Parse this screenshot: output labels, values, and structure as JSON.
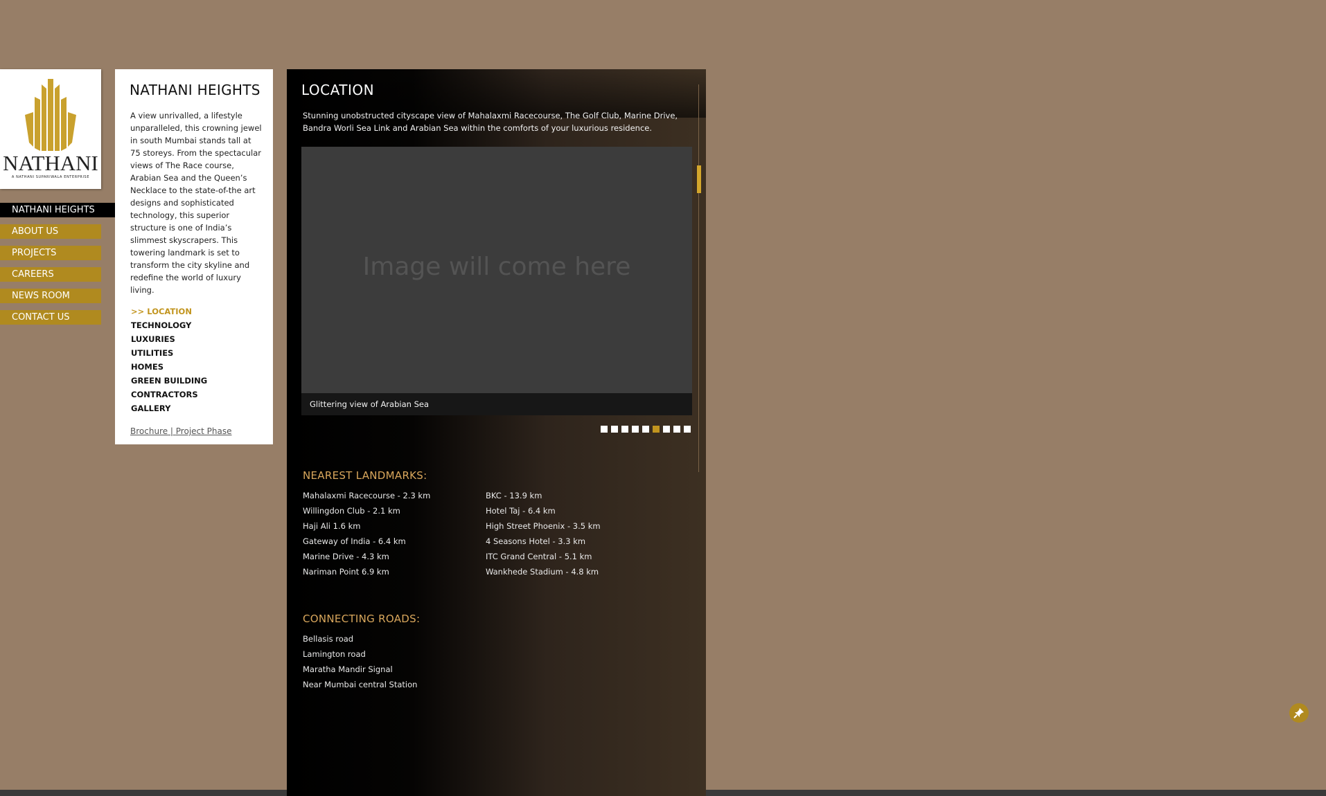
{
  "colors": {
    "background": "#977e67",
    "accent_gold": "#b08a1f",
    "active_gold": "#c2951f",
    "heading_tan": "#d9a75c",
    "panel_white": "#ffffff",
    "panel_dark": "#000000"
  },
  "logo": {
    "wordmark": "NATHANI",
    "tagline": "A NATHANI SUPARIWALA ENTERPRISE",
    "icon": "nathani-crown-logo"
  },
  "nav": {
    "active": "NATHANI HEIGHTS",
    "items": [
      {
        "label": "ABOUT US"
      },
      {
        "label": "PROJECTS"
      },
      {
        "label": "CAREERS"
      },
      {
        "label": "NEWS ROOM"
      },
      {
        "label": "CONTACT US"
      }
    ]
  },
  "info": {
    "title": "NATHANI HEIGHTS",
    "description": "A view unrivalled, a lifestyle unparalleled, this crowning jewel in south Mumbai stands tall at 75 storeys. From the spectacular views of The Race course, Arabian Sea and the Queen’s Necklace to the state-of-the art designs and sophisticated technology, this superior structure is one of India’s slimmest skyscrapers. This towering landmark is set to transform the city skyline and redefine the world of luxury living.",
    "sub_nav": [
      {
        "label": ">> LOCATION",
        "active": true
      },
      {
        "label": "TECHNOLOGY"
      },
      {
        "label": "LUXURIES"
      },
      {
        "label": "UTILITIES"
      },
      {
        "label": "HOMES"
      },
      {
        "label": "GREEN BUILDING"
      },
      {
        "label": "CONTRACTORS"
      },
      {
        "label": "GALLERY"
      }
    ],
    "brochure_link": "Brochure",
    "separator": " | ",
    "phase_link": "Project Phase"
  },
  "main": {
    "title": "LOCATION",
    "intro": "Stunning unobstructed cityscape view of Mahalaxmi Racecourse, The Golf Club, Marine Drive, Bandra Worli Sea Link and Arabian Sea within the comforts of your luxurious residence.",
    "slideshow": {
      "placeholder": "Image will come here",
      "caption": "Glittering view of Arabian Sea",
      "dot_count": 9,
      "active_dot": 6
    },
    "landmarks_heading": "NEAREST LANDMARKS:",
    "landmarks_left": [
      "Mahalaxmi Racecourse - 2.3 km",
      "Willingdon Club - 2.1 km",
      "Haji Ali 1.6 km",
      "Gateway of India - 6.4 km",
      "Marine Drive - 4.3 km",
      "Nariman Point 6.9 km"
    ],
    "landmarks_right": [
      "BKC - 13.9 km",
      "Hotel Taj - 6.4 km",
      "High Street Phoenix - 3.5 km",
      "4 Seasons Hotel - 3.3 km",
      "ITC Grand Central - 5.1 km",
      "Wankhede Stadium - 4.8 km"
    ],
    "roads_heading": "CONNECTING ROADS:",
    "roads": [
      "Bellasis road",
      "Lamington road",
      "Maratha Mandir Signal",
      "Near Mumbai central Station"
    ]
  },
  "floating_button": {
    "icon": "pin-icon"
  }
}
